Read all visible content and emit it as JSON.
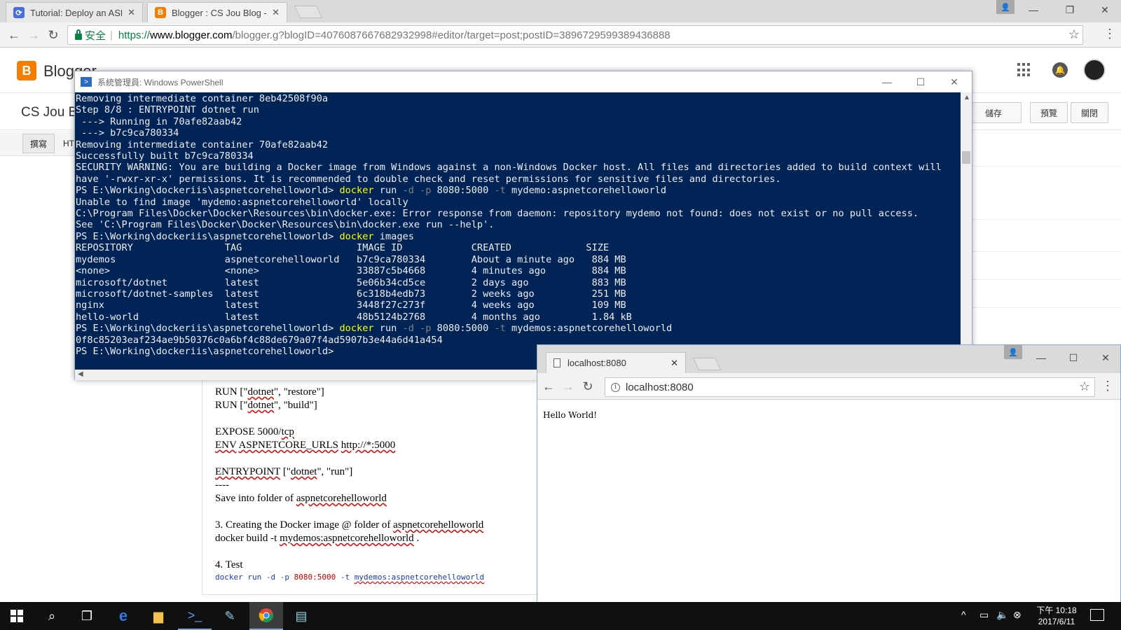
{
  "browser": {
    "tabs": [
      {
        "title": "Tutorial: Deploy an ASP",
        "favicon_color": "#4a6fd8"
      },
      {
        "title": "Blogger : CS Jou Blog -",
        "favicon_color": "#f57d00"
      }
    ],
    "address": {
      "secure_label": "安全",
      "scheme": "https://",
      "host": "www.blogger.com",
      "rest": "/blogger.g?blogID=4076087667682932998#editor/target=post;postID=3896729599389436888"
    }
  },
  "blogger": {
    "brand": "Blogger",
    "blog_title": "CS Jou Bl",
    "buttons": {
      "save": "儲存",
      "preview": "預覽",
      "close": "關閉"
    },
    "mode_tabs": {
      "compose": "撰寫",
      "html": "HT"
    },
    "sidebar": {
      "item1": "定",
      "item2": "時間",
      "item3": "結"
    },
    "doc": {
      "line1_a": "RUN [\"",
      "line1_b": "dotnet",
      "line1_c": "\", \"restore\"]",
      "line2_a": "RUN [\"",
      "line2_b": "dotnet",
      "line2_c": "\", \"build\"]",
      "line3_a": "EXPOSE 5000/",
      "line3_b": "tcp",
      "line4_a": "ENV",
      "line4_b": "ASPNETCORE_URLS",
      "line4_c": "http://*:5000",
      "line5_a": "ENTRYPOINT",
      "line5_b": " [\"",
      "line5_c": "dotnet",
      "line5_d": "\", \"run\"]",
      "line6": "----",
      "line7_a": "Save into folder of ",
      "line7_b": "aspnetcorehelloworld",
      "line8_a": "3.  Creating the Docker image @ folder of ",
      "line8_b": "aspnetcorehelloworld",
      "line9_a": "docker build -t ",
      "line9_b": "mydemos:aspnetcorehelloworld",
      "line9_c": " .",
      "line10": "4. Test",
      "line11_a": "docker run -d -p ",
      "line11_num": "8080:5000",
      "line11_b": " -t ",
      "line11_c": "mydemos:aspnetcorehelloworld"
    }
  },
  "powershell": {
    "title": "系統管理員: Windows PowerShell",
    "lines": [
      "Removing intermediate container 8eb42508f90a",
      "Step 8/8 : ENTRYPOINT dotnet run",
      " ---> Running in 70afe82aab42",
      " ---> b7c9ca780334",
      "Removing intermediate container 70afe82aab42",
      "Successfully built b7c9ca780334",
      "SECURITY WARNING: You are building a Docker image from Windows against a non-Windows Docker host. All files and directories added to build context will",
      "have '-rwxr-xr-x' permissions. It is recommended to double check and reset permissions for sensitive files and directories."
    ],
    "prompt": "PS E:\\Working\\dockeriis\\aspnetcorehelloworld> ",
    "cmd1": {
      "exe": "docker",
      "a": " run ",
      "p1": "-d",
      "b": " ",
      "p2": "-p",
      "c": " 8080:5000 ",
      "p3": "-t",
      "d": " mydemo:aspnetcorehelloworld"
    },
    "lines2": [
      "Unable to find image 'mydemo:aspnetcorehelloworld' locally",
      "C:\\Program Files\\Docker\\Docker\\Resources\\bin\\docker.exe: Error response from daemon: repository mydemo not found: does not exist or no pull access.",
      "See 'C:\\Program Files\\Docker\\Docker\\Resources\\bin\\docker.exe run --help'."
    ],
    "cmd2": {
      "exe": "docker",
      "a": " images"
    },
    "images_table": [
      "REPOSITORY                TAG                    IMAGE ID            CREATED             SIZE",
      "mydemos                   aspnetcorehelloworld   b7c9ca780334        About a minute ago   884 MB",
      "<none>                    <none>                 33887c5b4668        4 minutes ago        884 MB",
      "microsoft/dotnet          latest                 5e06b34cd5ce        2 days ago           883 MB",
      "microsoft/dotnet-samples  latest                 6c318b4edb73        2 weeks ago          251 MB",
      "nginx                     latest                 3448f27c273f        4 weeks ago          109 MB",
      "hello-world               latest                 48b5124b2768        4 months ago         1.84 kB"
    ],
    "cmd3": {
      "exe": "docker",
      "a": " run ",
      "p1": "-d",
      "b": " ",
      "p2": "-p",
      "c": " 8080:5000 ",
      "p3": "-t",
      "d": " mydemos:aspnetcorehelloworld"
    },
    "container_id": "0f8c85203eaf234ae9b50376c0a6bf4c88de679a07f4ad5907b3e44a6d41a454"
  },
  "localhost": {
    "tab_title": "localhost:8080",
    "address": "localhost:8080",
    "body_text": "Hello World!"
  },
  "taskbar": {
    "time": "下午 10:18",
    "date": "2017/6/11"
  }
}
